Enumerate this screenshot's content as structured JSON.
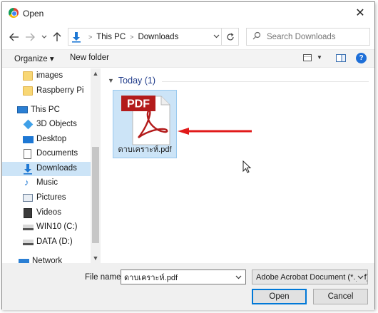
{
  "window": {
    "title": "Open",
    "close_glyph": "✕"
  },
  "address": {
    "crumbs": [
      "This PC",
      "Downloads"
    ],
    "search_placeholder": "Search Downloads"
  },
  "toolbar": {
    "organize_label": "Organize ▾",
    "new_folder_label": "New folder",
    "help_glyph": "?"
  },
  "nav": {
    "items": [
      {
        "label": "images",
        "icon": "folder-icon"
      },
      {
        "label": "Raspberry Pi",
        "icon": "folder-icon"
      },
      {
        "label": "This PC",
        "icon": "this-pc-icon"
      },
      {
        "label": "3D Objects",
        "icon": "3d-objects-icon"
      },
      {
        "label": "Desktop",
        "icon": "desktop-icon"
      },
      {
        "label": "Documents",
        "icon": "documents-icon"
      },
      {
        "label": "Downloads",
        "icon": "downloads-icon",
        "selected": true
      },
      {
        "label": "Music",
        "icon": "music-icon"
      },
      {
        "label": "Pictures",
        "icon": "pictures-icon"
      },
      {
        "label": "Videos",
        "icon": "videos-icon"
      },
      {
        "label": "WIN10 (C:)",
        "icon": "drive-c-icon"
      },
      {
        "label": "DATA (D:)",
        "icon": "drive-d-icon"
      },
      {
        "label": "Network",
        "icon": "network-icon"
      }
    ]
  },
  "content": {
    "group_header": "Today (1)",
    "file": {
      "name": "ดาบเคราะห์.pdf",
      "icon": "pdf-file-icon",
      "badge": "PDF"
    }
  },
  "footer": {
    "file_name_label": "File name:",
    "file_name_value": "ดาบเคราะห์.pdf",
    "file_type": "Adobe Acrobat Document (*.pdf)",
    "open_label": "Open",
    "cancel_label": "Cancel"
  },
  "colors": {
    "selection": "#cce4f7",
    "arrow": "#e11a1a",
    "pdf_red": "#b31b1b",
    "accent": "#0078d7"
  }
}
